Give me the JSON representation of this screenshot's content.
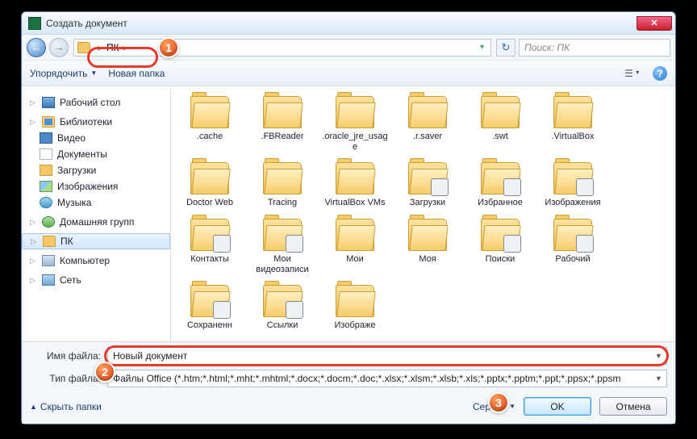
{
  "window": {
    "title": "Создать документ"
  },
  "nav": {
    "address_parts": [
      "ПК"
    ],
    "search_placeholder": "Поиск: ПК"
  },
  "toolbar": {
    "organize": "Упорядочить",
    "new_folder": "Новая папка"
  },
  "sidebar": {
    "items": [
      {
        "label": "Рабочий стол",
        "icon": "desktop",
        "group": true
      },
      {
        "label": "Библиотеки",
        "icon": "lib",
        "group": true
      },
      {
        "label": "Видео",
        "icon": "video"
      },
      {
        "label": "Документы",
        "icon": "doc"
      },
      {
        "label": "Загрузки",
        "icon": "down"
      },
      {
        "label": "Изображения",
        "icon": "pic"
      },
      {
        "label": "Музыка",
        "icon": "music"
      },
      {
        "label": "Домашняя групп",
        "icon": "home",
        "group": true
      },
      {
        "label": "ПК",
        "icon": "folder",
        "group": true,
        "selected": true
      },
      {
        "label": "Компьютер",
        "icon": "pc",
        "group": true
      },
      {
        "label": "Сеть",
        "icon": "net",
        "group": true
      }
    ]
  },
  "folders": [
    {
      "label": ".cache"
    },
    {
      "label": ".FBReader"
    },
    {
      "label": ".oracle_jre_usage"
    },
    {
      "label": ".r.saver"
    },
    {
      "label": ".swt"
    },
    {
      "label": ".VirtualBox"
    },
    {
      "label": "Doctor Web"
    },
    {
      "label": "Tracing"
    },
    {
      "label": "VirtualBox VMs"
    },
    {
      "label": "Загрузки",
      "badge": true
    },
    {
      "label": "Избранное",
      "badge": true
    },
    {
      "label": "Изображения",
      "badge": true
    },
    {
      "label": "Контакты",
      "badge": true
    },
    {
      "label": "Мои видеозаписи",
      "badge": true
    },
    {
      "label": "Мои"
    },
    {
      "label": "Моя"
    },
    {
      "label": "Поиски",
      "badge": true
    },
    {
      "label": "Рабочий",
      "badge": true
    },
    {
      "label": "Сохраненн",
      "badge": true
    },
    {
      "label": "Ссылки",
      "badge": true
    },
    {
      "label": "Изображе"
    }
  ],
  "form": {
    "filename_label": "Имя файла:",
    "filename_value": "Новый документ",
    "filetype_label": "Тип файла:",
    "filetype_value": "Файлы Office (*.htm;*.html;*.mht;*.mhtml;*.docx;*.docm;*.doc;*.xlsx;*.xlsm;*.xlsb;*.xls;*.pptx;*.pptm;*.ppt;*.ppsx;*.ppsm"
  },
  "footer": {
    "hide_folders": "Скрыть папки",
    "tools": "Сервис",
    "ok": "OK",
    "cancel": "Отмена"
  },
  "markers": {
    "m1": "1",
    "m2": "2",
    "m3": "3"
  }
}
